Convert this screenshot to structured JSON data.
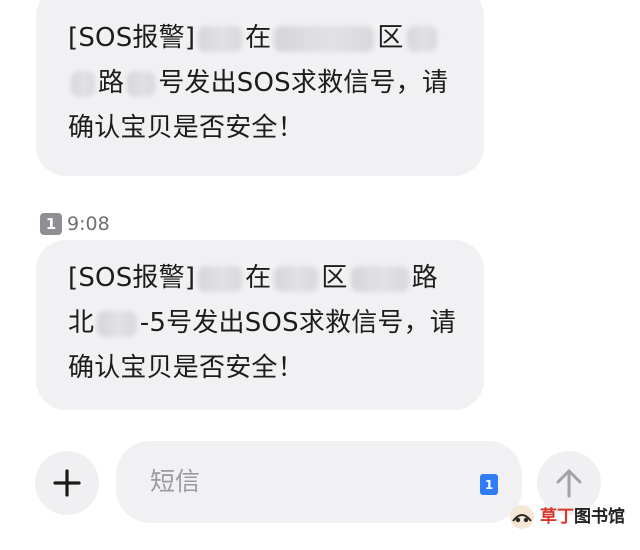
{
  "messages": [
    {
      "lines": [
        [
          {
            "type": "text",
            "value": "[SOS报警]"
          },
          {
            "type": "blur",
            "width": 44
          },
          {
            "type": "text",
            "value": "在"
          },
          {
            "type": "blur",
            "width": 100
          },
          {
            "type": "text",
            "value": "区"
          },
          {
            "type": "blur",
            "width": 30
          }
        ],
        [
          {
            "type": "blur",
            "width": 24
          },
          {
            "type": "text",
            "value": "路"
          },
          {
            "type": "blur",
            "width": 28
          },
          {
            "type": "text",
            "value": "号发出SOS求救信号，请"
          }
        ],
        [
          {
            "type": "text",
            "value": "确认宝贝是否安全！"
          }
        ]
      ]
    },
    {
      "lines": [
        [
          {
            "type": "text",
            "value": "[SOS报警]"
          },
          {
            "type": "blur",
            "width": 44
          },
          {
            "type": "text",
            "value": "在"
          },
          {
            "type": "blur",
            "width": 44
          },
          {
            "type": "text",
            "value": "区"
          },
          {
            "type": "blur",
            "width": 58
          },
          {
            "type": "text",
            "value": "路"
          }
        ],
        [
          {
            "type": "text",
            "value": "北"
          },
          {
            "type": "blur",
            "width": 42
          },
          {
            "type": "text",
            "value": "-5号发出SOS求救信号，请"
          }
        ],
        [
          {
            "type": "text",
            "value": "确认宝贝是否安全！"
          }
        ]
      ]
    }
  ],
  "timestamp": {
    "sim_label": "1",
    "time": "9:08"
  },
  "composer": {
    "placeholder": "短信",
    "sim_label": "1",
    "add_icon": "plus-icon",
    "send_icon": "arrow-up-icon"
  },
  "watermark": {
    "brand_red": "草丁",
    "brand_black": "图书馆"
  },
  "colors": {
    "bubble": "#f1f1f3",
    "text": "#1c1c1c",
    "sim_badge": "#8e8e93",
    "sim_blue": "#2f7cf6",
    "watermark_red": "#d8362b"
  }
}
